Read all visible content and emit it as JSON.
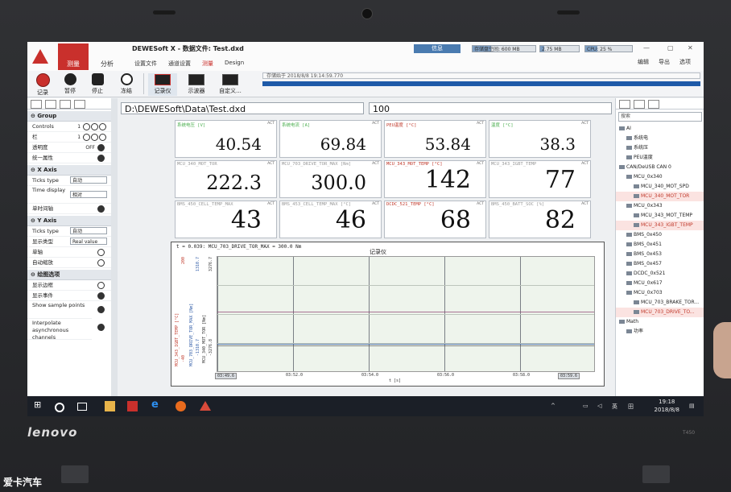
{
  "app": {
    "title": "DEWESoft X - 数据文件: Test.dxd",
    "modes": [
      "测量",
      "分析"
    ],
    "menu_tabs": [
      "设置文件",
      "通道设置",
      "测量",
      "Design"
    ],
    "active_menu_tab": "测量",
    "info_button": "信息",
    "meters": [
      {
        "label": "存储盘空间: 600 MB",
        "fill": 0.3
      },
      {
        "label": "2.75 MB",
        "fill": 0.1
      },
      {
        "label": "CPU: 25 %",
        "fill": 0.25
      }
    ],
    "top_right": [
      "编辑",
      "导出",
      "选项"
    ],
    "accent_color": "#c9302c"
  },
  "toolbar": {
    "buttons": [
      "记录",
      "暂停",
      "停止",
      "冻结"
    ],
    "instruments": [
      "记录仪",
      "示波器",
      "自定义..."
    ],
    "status_text": "存储始于 2018/8/8 19:14:59.770"
  },
  "left_panel": {
    "group": {
      "title": "Group",
      "controls_label": "Controls",
      "controls_value": "1",
      "columns_label": "栏",
      "columns_value": "1",
      "transparency_label": "透明度",
      "transparency_value": "OFF",
      "unify_label": "统一属性"
    },
    "x_axis": {
      "title": "X Axis",
      "ticks_label": "Ticks type",
      "ticks_value": "自动",
      "time_label": "Time display",
      "time_value": "相对",
      "single_time_label": "单时间轴"
    },
    "y_axis": {
      "title": "Y Axis",
      "ticks_label": "Ticks type",
      "ticks_value": "自动",
      "display_label": "显示类型",
      "display_value": "Real value",
      "single_label": "单轴",
      "autoscale_label": "自动缩放"
    },
    "plot_options": {
      "title": "绘图选项",
      "items": [
        "显示边框",
        "显示事件",
        "Show sample points",
        "Interpolate asynchronous channels"
      ]
    }
  },
  "file": {
    "path": "D:\\DEWESoft\\Data\\Test.dxd",
    "number": "100"
  },
  "displays": [
    {
      "label": "系统电压 [V]",
      "value": "40.54",
      "color": "green"
    },
    {
      "label": "系统电流 [A]",
      "value": "69.84",
      "color": "green"
    },
    {
      "label": "PEU温度 [°C]",
      "value": "53.84",
      "color": "red"
    },
    {
      "label": "温度 [°C]",
      "value": "38.3",
      "color": "green"
    },
    {
      "label": "MCU_340_MOT_TOR",
      "value": "222.3",
      "color": "gray"
    },
    {
      "label": "MCU_703_DRIVE_TOR_MAX [Nm]",
      "value": "300.0",
      "color": "gray"
    },
    {
      "label": "MCU_343_MOT_TEMP [°C]",
      "value": "142",
      "color": "red"
    },
    {
      "label": "MCU_343_IGBT_TEMP",
      "value": "77",
      "color": "gray"
    },
    {
      "label": "BMS_450_CELL_TEMP_MAX",
      "value": "43",
      "color": "gray"
    },
    {
      "label": "BMS_453_CELL_TEMP_MAX [°C]",
      "value": "46",
      "color": "gray"
    },
    {
      "label": "DCDC_521_TEMP [°C]",
      "value": "68",
      "color": "red"
    },
    {
      "label": "BMS_450_BATT_SOC [%]",
      "value": "82",
      "color": "gray"
    }
  ],
  "recorder": {
    "title": "记录仪",
    "cursor_text": "t = 0.039: MCU_703_DRIVE_TOR_MAX = 300.0 Nm",
    "x_ticks": [
      "03:49.6",
      "03:52.0",
      "03:54.0",
      "03:56.0",
      "03:58.0",
      "03:59.6"
    ],
    "x_label": "t [s]",
    "y_axes": [
      {
        "name": "MCU_343_IGBT_TEMP [°C]",
        "top": "200",
        "bottom": "-40",
        "color": "red"
      },
      {
        "name": "MCU_703_DRIVE_TOR_MAX [Nm]",
        "top": "1310.7",
        "bottom": "-1310.7",
        "color": "blue"
      },
      {
        "name": "MCU_340_MOT_TOR [Nm]",
        "top": "3276.7",
        "bottom": "-3276.8",
        "color": "gray"
      }
    ]
  },
  "channel_tree": {
    "search_placeholder": "搜索",
    "items": [
      {
        "text": "AI",
        "level": 0,
        "selected": false
      },
      {
        "text": "系统电",
        "level": 1,
        "selected": false
      },
      {
        "text": "系统压",
        "level": 1,
        "selected": false
      },
      {
        "text": "PEU温度",
        "level": 1,
        "selected": false
      },
      {
        "text": "CAN/DeUSB CAN 0",
        "level": 0,
        "selected": false
      },
      {
        "text": "MCU_0x340",
        "level": 1,
        "selected": false
      },
      {
        "text": "MCU_340_MOT_SPD",
        "level": 2,
        "selected": false
      },
      {
        "text": "MCU_340_MOT_TOR",
        "level": 2,
        "selected": true
      },
      {
        "text": "MCU_0x343",
        "level": 1,
        "selected": false
      },
      {
        "text": "MCU_343_MOT_TEMP",
        "level": 2,
        "selected": false
      },
      {
        "text": "MCU_343_IGBT_TEMP",
        "level": 2,
        "selected": true
      },
      {
        "text": "BMS_0x450",
        "level": 1,
        "selected": false
      },
      {
        "text": "BMS_0x451",
        "level": 1,
        "selected": false
      },
      {
        "text": "BMS_0x453",
        "level": 1,
        "selected": false
      },
      {
        "text": "BMS_0x457",
        "level": 1,
        "selected": false
      },
      {
        "text": "DCDC_0x521",
        "level": 1,
        "selected": false
      },
      {
        "text": "MCU_0x617",
        "level": 1,
        "selected": false
      },
      {
        "text": "MCU_0x703",
        "level": 1,
        "selected": false
      },
      {
        "text": "MCU_703_BRAKE_TOR...",
        "level": 2,
        "selected": false
      },
      {
        "text": "MCU_703_DRIVE_TO...",
        "level": 2,
        "selected": true
      },
      {
        "text": "Math",
        "level": 0,
        "selected": false
      },
      {
        "text": "功率",
        "level": 1,
        "selected": false
      }
    ]
  },
  "taskbar": {
    "time": "19:18",
    "date": "2018/8/8",
    "lang": "英"
  },
  "laptop": {
    "brand": "lenovo",
    "model": "T450"
  },
  "watermark": "爱卡汽车"
}
